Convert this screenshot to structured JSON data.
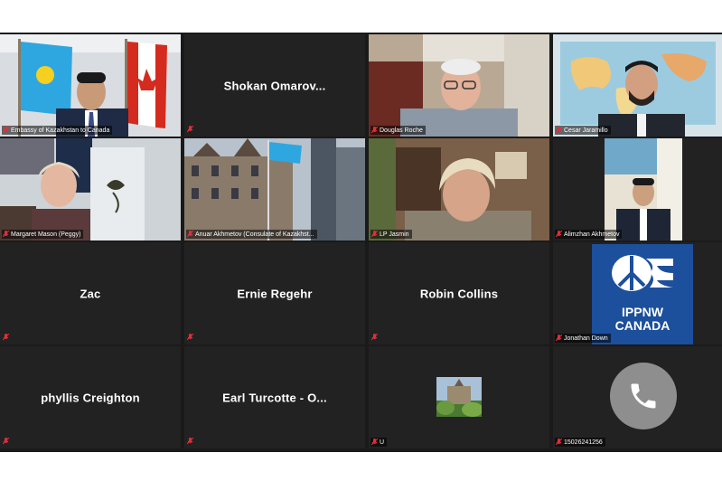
{
  "participants": {
    "t1": {
      "label": "Embassy of Kazakhstan to Canada"
    },
    "t2": {
      "name": "Shokan  Omarov..."
    },
    "t3": {
      "label": "Douglas Roche"
    },
    "t4": {
      "label": "Cesar Jaramillo"
    },
    "t5": {
      "label": "Margaret Mason (Peggy)"
    },
    "t6": {
      "label": "Anuar Akhmetov (Consulate of Kazakhst..."
    },
    "t7": {
      "label": "LP Jasmin"
    },
    "t8": {
      "label": "Alimzhan Akhmetov"
    },
    "t9": {
      "name": "Zac"
    },
    "t10": {
      "name": "Ernie Regehr"
    },
    "t11": {
      "name": "Robin Collins"
    },
    "t12": {
      "label": "Jonathan Down",
      "logo_line1": "IPPNW",
      "logo_line2": "CANADA"
    },
    "t13": {
      "name": "phyllis Creighton"
    },
    "t14": {
      "name": "Earl Turcotte - O..."
    },
    "t15": {
      "label": "U"
    },
    "t16": {
      "label": "15026241256"
    }
  },
  "colors": {
    "active_speaker_border": "#c8e63c",
    "tile_background": "#222222",
    "muted_icon": "#e0303a",
    "ippnw_blue": "#1c4f9c",
    "phone_circle": "#8e8e8e"
  },
  "icons": {
    "muted": "microphone-muted-icon",
    "phone": "phone-icon",
    "ippnw_logo": "peace-globe-logo"
  }
}
